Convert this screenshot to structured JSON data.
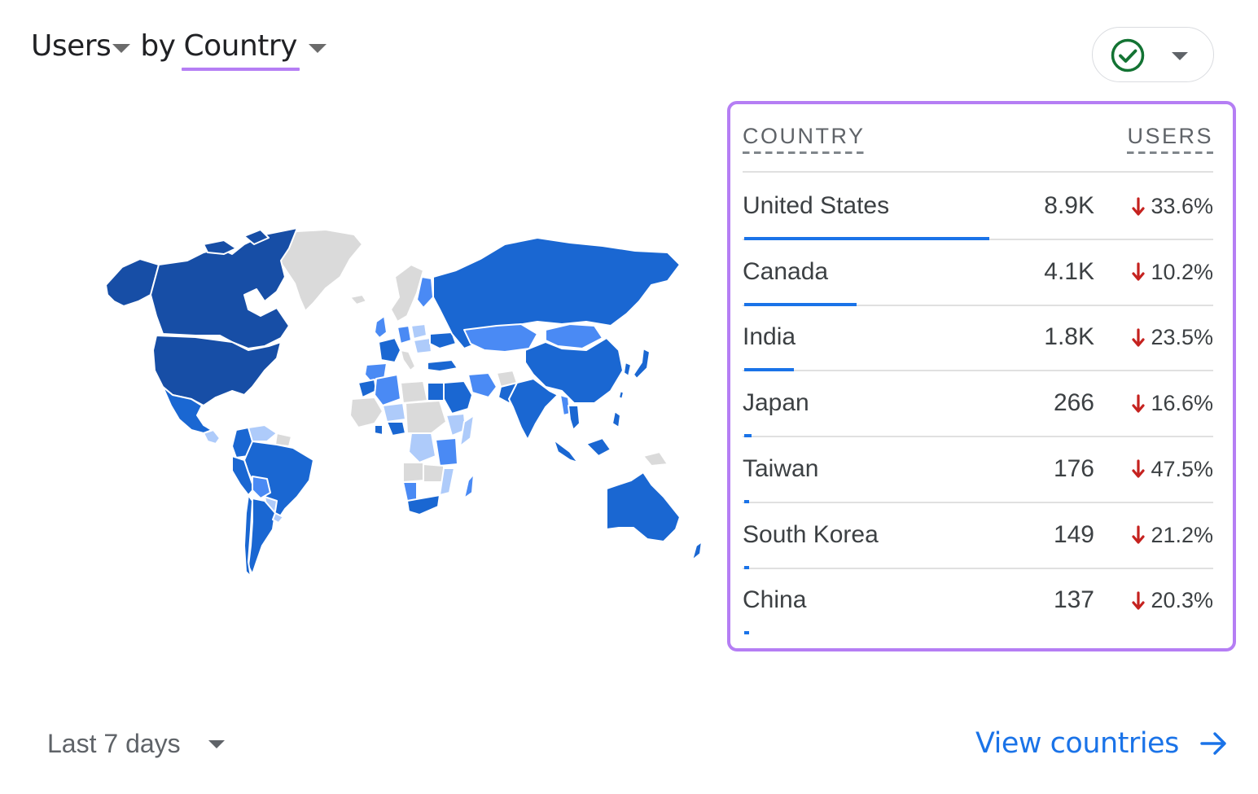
{
  "header": {
    "metric_label": "Users",
    "connector": "by",
    "dimension_label": "Country",
    "status_icon": "check-circle-icon",
    "status_color": "#137333"
  },
  "table": {
    "columns": [
      "COUNTRY",
      "USERS"
    ],
    "rows": [
      {
        "country": "United States",
        "users": "8.9K",
        "users_value": 8900,
        "change": "33.6%",
        "direction": "down"
      },
      {
        "country": "Canada",
        "users": "4.1K",
        "users_value": 4100,
        "change": "10.2%",
        "direction": "down"
      },
      {
        "country": "India",
        "users": "1.8K",
        "users_value": 1800,
        "change": "23.5%",
        "direction": "down"
      },
      {
        "country": "Japan",
        "users": "266",
        "users_value": 266,
        "change": "16.6%",
        "direction": "down"
      },
      {
        "country": "Taiwan",
        "users": "176",
        "users_value": 176,
        "change": "47.5%",
        "direction": "down"
      },
      {
        "country": "South Korea",
        "users": "149",
        "users_value": 149,
        "change": "21.2%",
        "direction": "down"
      },
      {
        "country": "China",
        "users": "137",
        "users_value": 137,
        "change": "20.3%",
        "direction": "down"
      }
    ]
  },
  "footer": {
    "date_range": "Last 7 days",
    "view_link": "View countries"
  },
  "colors": {
    "accent": "#1a73e8",
    "highlight_border": "#b57ef4",
    "down_arrow": "#c5221f",
    "map_darkest": "#174ea6",
    "map_dark": "#1a67d2",
    "map_mid": "#4a8af4",
    "map_light": "#aecbfa",
    "map_nodata": "#dadada"
  }
}
